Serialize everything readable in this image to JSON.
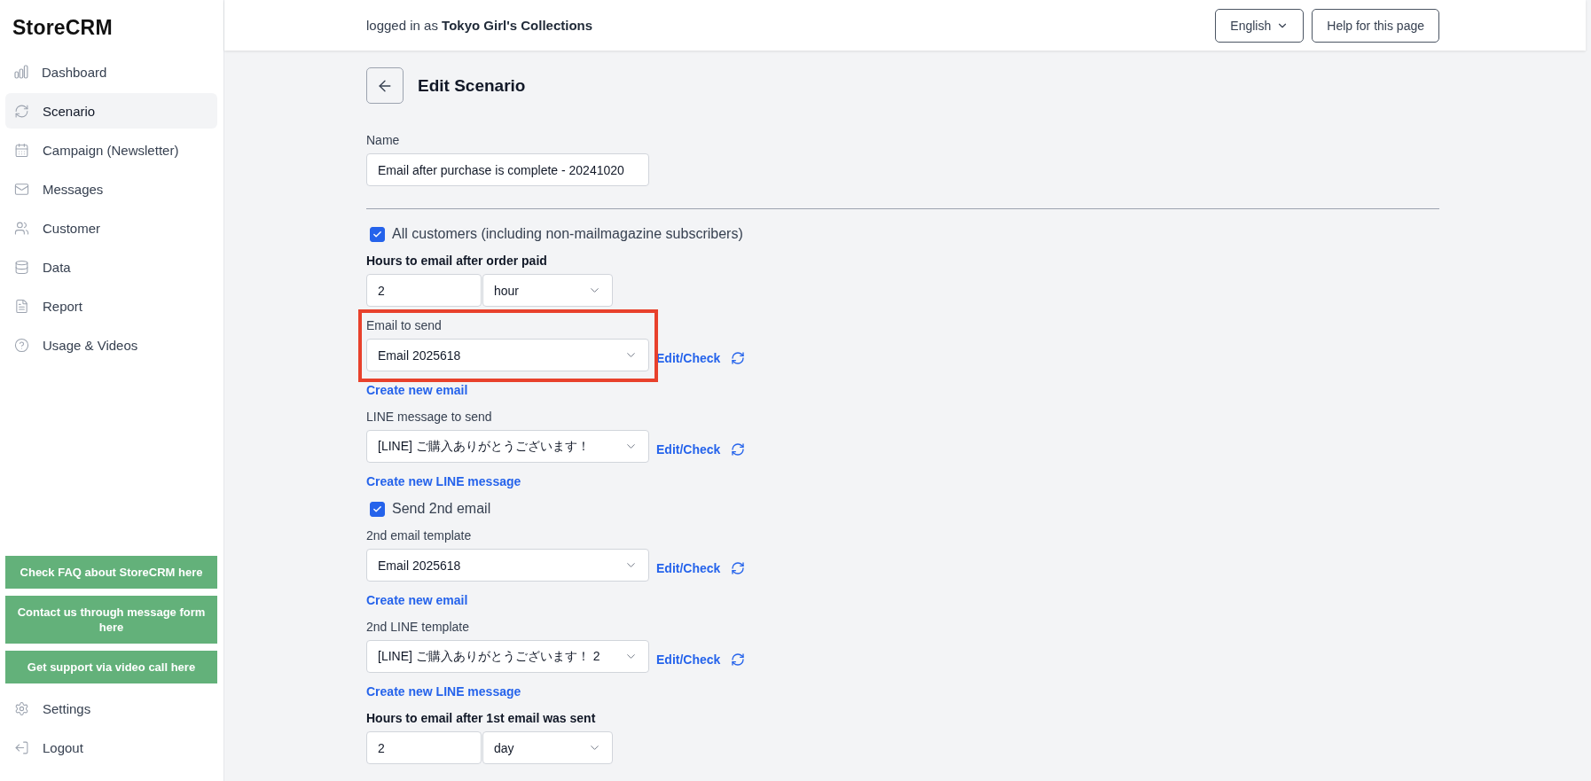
{
  "sidebar": {
    "logo": "StoreCRM",
    "items": [
      {
        "label": "Dashboard",
        "selected": false
      },
      {
        "label": "Scenario",
        "selected": true
      },
      {
        "label": "Campaign (Newsletter)",
        "selected": false
      },
      {
        "label": "Messages",
        "selected": false
      },
      {
        "label": "Customer",
        "selected": false
      },
      {
        "label": "Data",
        "selected": false
      },
      {
        "label": "Report",
        "selected": false
      },
      {
        "label": "Usage & Videos",
        "selected": false
      }
    ],
    "support_buttons": [
      "Check FAQ about StoreCRM here",
      "Contact us through message form here",
      "Get support via video call here"
    ],
    "bottom_items": [
      {
        "label": "Settings"
      },
      {
        "label": "Logout"
      }
    ]
  },
  "header": {
    "login_text": "logged in as **Tokyo Girl's Collections**",
    "language": "English",
    "help_button": "Help for this page"
  },
  "page": {
    "title": "Edit Scenario",
    "name_label": "Name",
    "name_value": "Email after purchase is complete - 20241020",
    "items": [
      {
        "kind": "checkbox",
        "label": "All customers (including non-mailmagazine subscribers)",
        "checked": true
      },
      {
        "kind": "duration",
        "label": "Hours to email after order paid",
        "amount": "2",
        "unit": "hour"
      },
      {
        "kind": "template",
        "label": "Email to send",
        "value": "Email 2025618",
        "action": "Edit/Check",
        "create": "Create new email",
        "highlighted": true
      },
      {
        "kind": "template",
        "label": "LINE message to send",
        "value": "[LINE] ご購入ありがとうございます！",
        "action": "Edit/Check",
        "create": "Create new LINE message",
        "highlighted": false
      },
      {
        "kind": "checkbox",
        "label": "Send 2nd email",
        "checked": true
      },
      {
        "kind": "template",
        "label": "2nd email template",
        "value": "Email 2025618",
        "action": "Edit/Check",
        "create": "Create new email",
        "highlighted": false
      },
      {
        "kind": "template",
        "label": "2nd LINE template",
        "value": "[LINE] ご購入ありがとうございます！ 2",
        "action": "Edit/Check",
        "create": "Create new LINE message",
        "highlighted": false
      },
      {
        "kind": "duration",
        "label": "Hours to email after 1st email was sent",
        "amount": "2",
        "unit": "day"
      }
    ]
  }
}
